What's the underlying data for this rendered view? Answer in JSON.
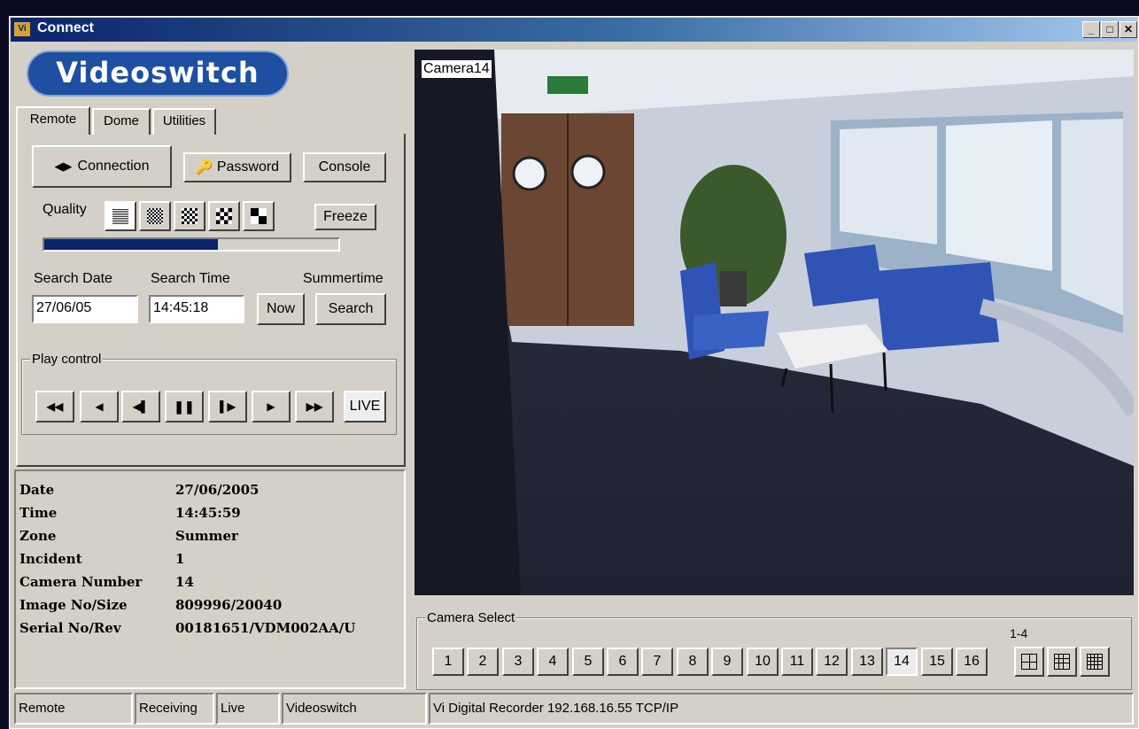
{
  "window": {
    "title": "Connect",
    "app_icon": "Vi"
  },
  "logo": {
    "text": "Videoswitch"
  },
  "tabs": [
    {
      "label": "Remote"
    },
    {
      "label": "Dome"
    },
    {
      "label": "Utilities"
    }
  ],
  "remote": {
    "connection_label": "Connection",
    "password_label": "Password",
    "console_label": "Console",
    "quality_label": "Quality",
    "freeze_label": "Freeze",
    "quality_progress": 0.59,
    "search_date_label": "Search Date",
    "search_time_label": "Search Time",
    "summertime_label": "Summertime",
    "search_date_value": "27/06/05",
    "search_time_value": "14:45:18",
    "now_label": "Now",
    "search_label": "Search",
    "play_control_label": "Play control",
    "live_label": "LIVE"
  },
  "info": [
    {
      "key": "Date",
      "value": "27/06/2005"
    },
    {
      "key": "Time",
      "value": "14:45:59"
    },
    {
      "key": "Zone",
      "value": "Summer"
    },
    {
      "key": "Incident",
      "value": "1"
    },
    {
      "key": "Camera Number",
      "value": "14"
    },
    {
      "key": "Image No/Size",
      "value": "809996/20040"
    },
    {
      "key": "Serial No/Rev",
      "value": "00181651/VDM002AA/U"
    }
  ],
  "video": {
    "camera_label": "Camera14"
  },
  "camera_select": {
    "label": "Camera Select",
    "range_label": "1-4",
    "cameras": [
      "1",
      "2",
      "3",
      "4",
      "5",
      "6",
      "7",
      "8",
      "9",
      "10",
      "11",
      "12",
      "13",
      "14",
      "15",
      "16"
    ],
    "selected": "14"
  },
  "status": {
    "mode": "Remote",
    "receiving": "Receiving",
    "live": "Live",
    "brand": "Videoswitch",
    "connection": "Vi Digital Recorder   192.168.16.55   TCP/IP"
  },
  "colors": {
    "title_start": "#0a246a",
    "title_end": "#a6caf0",
    "progress": "#0a246a",
    "logo_bg": "#1f4fa0",
    "face": "#d4d0c8"
  }
}
